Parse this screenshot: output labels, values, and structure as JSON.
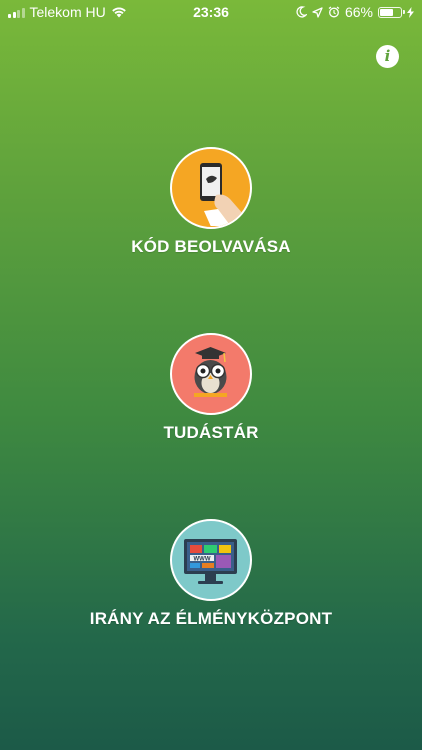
{
  "status_bar": {
    "carrier": "Telekom HU",
    "time": "23:36",
    "battery_percent": "66%",
    "battery_level": 0.66
  },
  "info": {
    "glyph": "i"
  },
  "menu": [
    {
      "label": "KÓD BEOLVAVÁSA",
      "icon": "phone-scan-icon",
      "color": "#f5a623"
    },
    {
      "label": "TUDÁSTÁR",
      "icon": "owl-icon",
      "color": "#f37a6b"
    },
    {
      "label": "IRÁNY AZ ÉLMÉNYKÖZPONT",
      "icon": "monitor-www-icon",
      "color": "#7ec9c9",
      "screen_text": "WWW"
    }
  ]
}
